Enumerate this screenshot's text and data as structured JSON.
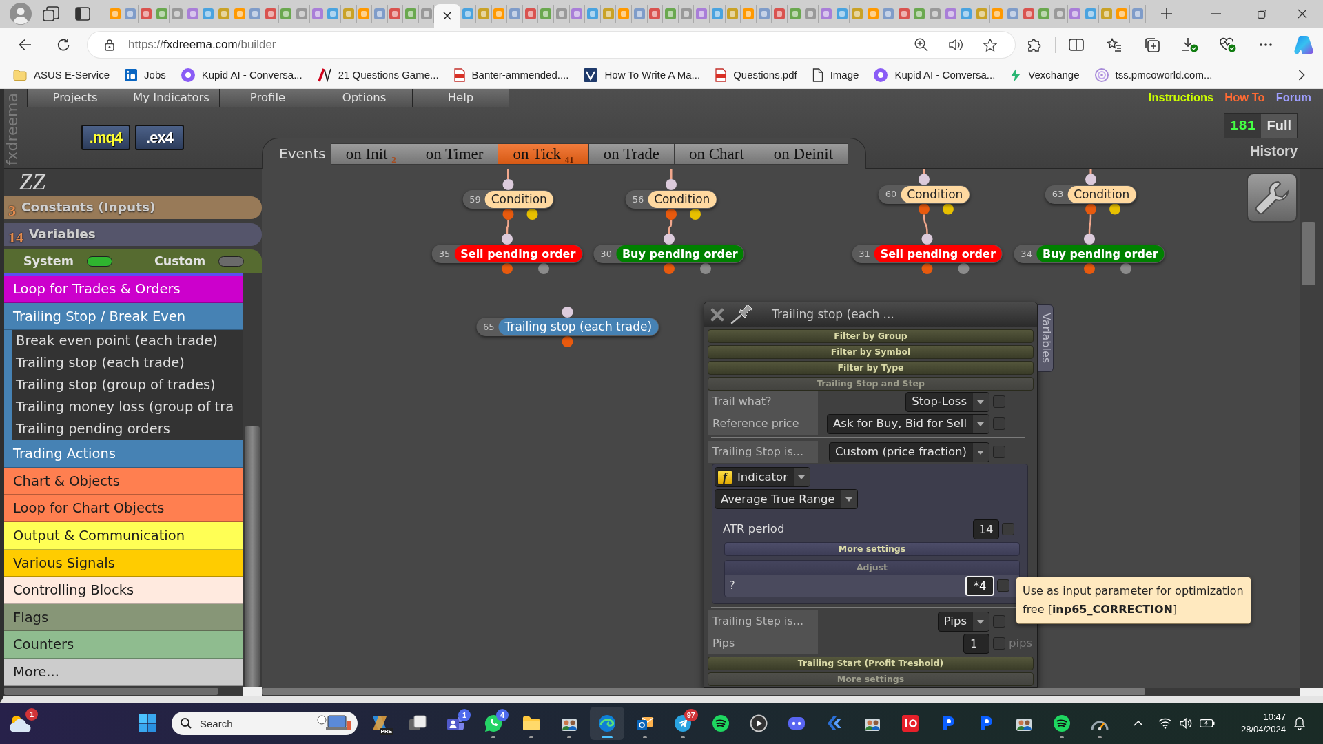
{
  "browser": {
    "tabs": [
      {
        "selected": false
      },
      {
        "selected": false
      },
      {
        "selected": false
      },
      {
        "selected": false
      },
      {
        "selected": false
      },
      {
        "selected": false
      },
      {
        "selected": false
      },
      {
        "selected": false
      },
      {
        "selected": false
      },
      {
        "selected": false
      },
      {
        "selected": false
      },
      {
        "selected": false
      },
      {
        "selected": false
      },
      {
        "selected": false
      },
      {
        "selected": false
      },
      {
        "selected": false
      },
      {
        "selected": false
      },
      {
        "selected": false
      },
      {
        "selected": false
      },
      {
        "selected": false
      },
      {
        "selected": false
      },
      {
        "selected": true
      },
      {
        "selected": false
      },
      {
        "selected": false
      },
      {
        "selected": false
      },
      {
        "selected": false
      },
      {
        "selected": false
      },
      {
        "selected": false
      },
      {
        "selected": false
      },
      {
        "selected": false
      },
      {
        "selected": false
      },
      {
        "selected": false
      },
      {
        "selected": false
      },
      {
        "selected": false
      },
      {
        "selected": false
      },
      {
        "selected": false
      },
      {
        "selected": false
      },
      {
        "selected": false
      },
      {
        "selected": false
      },
      {
        "selected": false
      },
      {
        "selected": false
      },
      {
        "selected": false
      },
      {
        "selected": false
      },
      {
        "selected": false
      },
      {
        "selected": false
      },
      {
        "selected": false
      },
      {
        "selected": false
      },
      {
        "selected": false
      },
      {
        "selected": false
      },
      {
        "selected": false
      },
      {
        "selected": false
      },
      {
        "selected": false
      },
      {
        "selected": false
      },
      {
        "selected": false
      },
      {
        "selected": false
      },
      {
        "selected": false
      },
      {
        "selected": false
      },
      {
        "selected": false
      },
      {
        "selected": false
      },
      {
        "selected": false
      },
      {
        "selected": false
      },
      {
        "selected": false
      },
      {
        "selected": false
      },
      {
        "selected": false
      },
      {
        "selected": false
      },
      {
        "selected": false
      }
    ],
    "url": {
      "scheme": "https://",
      "domain": "fxdreema.com",
      "path": "/builder"
    },
    "bookmarks": [
      {
        "label": "ASUS E-Service"
      },
      {
        "label": "Jobs"
      },
      {
        "label": "Kupid AI - Conversa..."
      },
      {
        "label": "21 Questions Game..."
      },
      {
        "label": "Banter-ammended...."
      },
      {
        "label": "How To Write A Ma..."
      },
      {
        "label": "Questions.pdf"
      },
      {
        "label": "Image"
      },
      {
        "label": "Kupid AI - Conversa..."
      },
      {
        "label": "Vexchange"
      },
      {
        "label": "tss.pmcoworld.com..."
      }
    ]
  },
  "app": {
    "brand": "fxdreema",
    "menu": [
      "Projects",
      "My Indicators",
      "Profile",
      "Options",
      "Help"
    ],
    "links": [
      {
        "label": "Instructions",
        "color": "#ccff00"
      },
      {
        "label": "How To",
        "color": "#ff6a33"
      },
      {
        "label": "Forum",
        "color": "#9f9fff"
      }
    ],
    "counter": {
      "value": "181",
      "label": "Full"
    },
    "history": "History",
    "exports": [
      {
        "label": ".mq4",
        "kind": "source"
      },
      {
        "label": ".ex4",
        "kind": "compiled"
      }
    ],
    "project": "ZZ",
    "constants": {
      "count": "3",
      "label": "Constants (Inputs)"
    },
    "variables": {
      "count": "14",
      "label": "Variables"
    },
    "toggles": [
      {
        "label": "System",
        "on": true
      },
      {
        "label": "Custom",
        "on": false
      }
    ],
    "categories": [
      {
        "label": "Loop for Trades & Orders",
        "color": "#cc00cc"
      },
      {
        "label": "Trailing Stop / Break Even",
        "color": "#4682b4",
        "children": [
          {
            "label": "Break even point (each trade)"
          },
          {
            "label": "Trailing stop (each trade)"
          },
          {
            "label": "Trailing stop (group of trades)"
          },
          {
            "label": "Trailing money loss (group of tra"
          },
          {
            "label": "Trailing pending orders"
          }
        ]
      },
      {
        "label": "Trading Actions",
        "color": "#4682b4"
      },
      {
        "label": "Chart & Objects",
        "color": "#ff7f50"
      },
      {
        "label": "Loop for Chart Objects",
        "color": "#ff7f50"
      },
      {
        "label": "Output & Communication",
        "color": "#ffff55"
      },
      {
        "label": "Various Signals",
        "color": "#ffcc00"
      },
      {
        "label": "Controlling Blocks",
        "color": "#ffeadf"
      },
      {
        "label": "Flags",
        "color": "#879677"
      },
      {
        "label": "Counters",
        "color": "#8fbc8f"
      },
      {
        "label": "More...",
        "color": "#cccccc"
      }
    ],
    "events": {
      "label": "Events",
      "tabs": [
        {
          "label": "on Init",
          "count": "2",
          "selected": false
        },
        {
          "label": "on Timer",
          "selected": false
        },
        {
          "label": "on Tick",
          "count": "41",
          "selected": true
        },
        {
          "label": "on Trade",
          "selected": false
        },
        {
          "label": "on Chart",
          "selected": false
        },
        {
          "label": "on Deinit",
          "selected": false
        }
      ]
    },
    "blocks": [
      {
        "number": "59",
        "label": "Condition",
        "kind": "condition",
        "color": "#ffd9a0",
        "linked_above": true,
        "children": [
          {
            "number": "35",
            "label": "Sell pending order",
            "kind": "order",
            "color": "#ff0000"
          }
        ]
      },
      {
        "number": "56",
        "label": "Condition",
        "kind": "condition",
        "color": "#ffd9a0",
        "linked_above": true,
        "children": [
          {
            "number": "30",
            "label": "Buy pending order",
            "kind": "order",
            "color": "#008000"
          }
        ]
      },
      {
        "number": "60",
        "label": "Condition",
        "kind": "condition",
        "color": "#ffd9a0",
        "linked_above": true,
        "children": [
          {
            "number": "31",
            "label": "Sell pending order",
            "kind": "order",
            "color": "#ff0000"
          }
        ]
      },
      {
        "number": "63",
        "label": "Condition",
        "kind": "condition",
        "color": "#ffd9a0",
        "linked_above": true,
        "children": [
          {
            "number": "34",
            "label": "Buy pending order",
            "kind": "order",
            "color": "#008000"
          }
        ]
      },
      {
        "number": "65",
        "label": "Trailing stop (each trade)",
        "kind": "trail",
        "color": "#4682b4",
        "linked_above": false
      }
    ],
    "dialog": {
      "title": "Trailing stop (each ...",
      "side_tab": "Variables",
      "items": [
        {
          "kind": "header",
          "label": "Filter by Group",
          "expanded": false
        },
        {
          "kind": "header",
          "label": "Filter by Symbol",
          "expanded": false
        },
        {
          "kind": "header",
          "label": "Filter by Type",
          "expanded": false
        },
        {
          "kind": "header",
          "label": "Trailing Stop and Step",
          "expanded": true
        },
        {
          "kind": "select",
          "label": "Trail what?",
          "value": "Stop-Loss",
          "checked": false
        },
        {
          "kind": "select",
          "label": "Reference price",
          "value": "Ask for Buy, Bid for Sell",
          "checked": false
        },
        {
          "kind": "divider"
        },
        {
          "kind": "select",
          "label": "Trailing Stop is...",
          "value": "Custom (price fraction)",
          "checked": false
        },
        {
          "kind": "panel",
          "items": [
            {
              "kind": "function",
              "glyph": "f",
              "value": "Indicator"
            },
            {
              "kind": "dropdown",
              "value": "Average True Range"
            },
            {
              "kind": "input",
              "label": "ATR period",
              "value": "14",
              "focused": false,
              "checked": false
            },
            {
              "kind": "header",
              "label": "More settings",
              "expanded": false
            },
            {
              "kind": "group",
              "label": "Adjust",
              "items": [
                {
                  "kind": "input",
                  "label": "?",
                  "value": "*4",
                  "focused": true,
                  "checked": false
                }
              ]
            }
          ]
        },
        {
          "kind": "divider"
        },
        {
          "kind": "select",
          "label": "Trailing Step is...",
          "value": "Pips",
          "checked": false
        },
        {
          "kind": "input",
          "label": "Pips",
          "value": "1",
          "unit": "pips",
          "focused": false,
          "checked": false
        },
        {
          "kind": "header",
          "label": "Trailing Start (Profit Treshold)",
          "expanded": false
        },
        {
          "kind": "header",
          "label": "More settings",
          "expanded": true
        }
      ]
    },
    "tooltip": {
      "lines": [
        "Use as input parameter for optimization",
        "free [**inp65_CORRECTION**]"
      ]
    }
  },
  "taskbar": {
    "widget": {
      "badge": {
        "text": "1",
        "color": "#d13438"
      }
    },
    "search_placeholder": "Search",
    "apps": [
      {
        "selected": false,
        "running": false,
        "tag": "PRE"
      },
      {
        "selected": false,
        "running": false
      },
      {
        "selected": false,
        "running": false,
        "badge": {
          "text": "1",
          "color": "#4f6bed"
        }
      },
      {
        "selected": false,
        "running": true,
        "badge": {
          "text": "4",
          "color": "#4f6bed"
        }
      },
      {
        "selected": false,
        "running": true
      },
      {
        "selected": false,
        "running": true
      },
      {
        "selected": true,
        "running": true
      },
      {
        "selected": false,
        "running": true
      },
      {
        "selected": false,
        "running": true,
        "badge": {
          "text": "97",
          "color": "#d13438"
        }
      },
      {
        "selected": false,
        "running": false
      },
      {
        "selected": false,
        "running": false
      },
      {
        "selected": false,
        "running": false
      },
      {
        "selected": false,
        "running": false
      },
      {
        "selected": false,
        "running": false
      },
      {
        "selected": false,
        "running": false
      },
      {
        "selected": false,
        "running": false
      },
      {
        "selected": false,
        "running": false
      },
      {
        "selected": false,
        "running": false
      },
      {
        "selected": false,
        "running": true
      },
      {
        "selected": false,
        "running": true
      }
    ],
    "time": "10:47",
    "date": "28/04/2024"
  }
}
